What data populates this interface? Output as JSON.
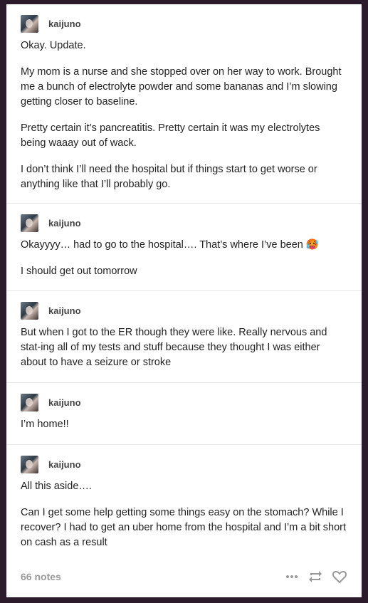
{
  "posts": [
    {
      "username": "kaijuno",
      "paragraphs": [
        "Okay. Update.",
        "My mom is a nurse and she stopped over on her way to work. Brought me a bunch of electrolyte powder and some bananas and I’m slowing getting closer to baseline.",
        "Pretty certain it’s pancreatitis. Pretty certain it was my electrolytes being waaay out of wack.",
        "I don’t think I’ll need the hospital but if things start to get worse or anything like that I’ll probably go."
      ]
    },
    {
      "username": "kaijuno",
      "paragraphs": [
        "Okayyyy… had to go to the hospital…. That’s where I’ve been 🥵",
        "I should get out tomorrow"
      ]
    },
    {
      "username": "kaijuno",
      "paragraphs": [
        "But when I got to the ER though they were like. Really nervous and stat-ing all of my tests and stuff because they thought I was either about to have a seizure or stroke"
      ]
    },
    {
      "username": "kaijuno",
      "paragraphs": [
        "I’m home!!"
      ]
    },
    {
      "username": "kaijuno",
      "paragraphs": [
        "All this aside….",
        "Can I get some help getting some things easy on the stomach? While I recover? I had to get an uber home from the hospital and I’m a bit short on cash as a result"
      ]
    }
  ],
  "footer": {
    "notes": "66 notes",
    "icons": [
      "more-icon",
      "reblog-icon",
      "like-icon"
    ]
  }
}
